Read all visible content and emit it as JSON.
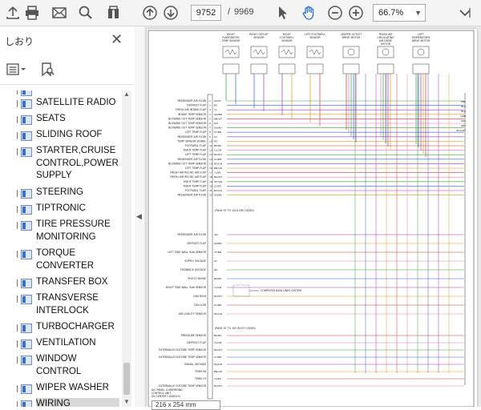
{
  "toolbar": {
    "icons": [
      "upload-icon",
      "print-icon",
      "email-icon",
      "search-icon",
      "bookmark-panel-icon",
      "prev-page-icon",
      "next-page-icon",
      "select-cursor-icon",
      "hand-tool-icon",
      "zoom-out-icon",
      "zoom-in-icon",
      "more-tools-icon"
    ],
    "page_current": "9752",
    "page_separator": "/",
    "page_total": "9969",
    "zoom": "66.7%"
  },
  "sidebar": {
    "title": "しおり",
    "items": [
      {
        "label": "SATELLITE RADIO"
      },
      {
        "label": "SEATS"
      },
      {
        "label": "SLIDING ROOF"
      },
      {
        "label": "STARTER,CRUISE CONTROL,POWER SUPPLY"
      },
      {
        "label": "STEERING"
      },
      {
        "label": "TIPTRONIC"
      },
      {
        "label": "TIRE PRESSURE MONITORING"
      },
      {
        "label": "TORQUE CONVERTER"
      },
      {
        "label": "TRANSFER BOX"
      },
      {
        "label": "TRANSVERSE INTERLOCK"
      },
      {
        "label": "TURBOCHARGER"
      },
      {
        "label": "VENTILATION"
      },
      {
        "label": "WINDOW CONTROL"
      },
      {
        "label": "WIPER WASHER"
      },
      {
        "label": "WIRING"
      }
    ]
  },
  "document": {
    "sensors": [
      "RIGHT EVAPORATOR TEMP SENSOR",
      "RIGHT OUTLET SENSOR",
      "RIGHT FOOTWELL SENSOR",
      "LEFT FOOTWELL SENSOR",
      "CENTER OUTLET DRIVE MOTOR",
      "FRESH AIR CIRCULATING AIR DRIVE MOTOR",
      "LEFT TEMPERATURE DRIVE MOTOR"
    ],
    "left_labels": [
      "PASSENGER AIR FLOW",
      "DEFROST FLAP",
      "FRESH AIR INTAKE FLAP",
      "INTAKE TEMP SENSOR",
      "BLOWING OUT TEMP SENSOR",
      "BLOWING OUT TEMP SENSOR",
      "BLOWING OUT TEMP SENSOR",
      "LEFT TEMP FLAP",
      "PASSENGER AIR FLOW",
      "TEMP SENSOR SIGNAL",
      "FOOTWELL FLAP",
      "RIGHT TEMP FLAP",
      "LEFT TEMP FLAP",
      "PASSENGER AIR FLOW",
      "BLOWING OUT TEMP SENSOR",
      "LEFT TEMP FLAP",
      "FRESH AIR RECIRC AIR FLAP",
      "FRESH AIR RECIRC AIR FLAP",
      "RIGHT TEMP FLAP",
      "RIGHT TEMP FLAP",
      "FOOTWELL FLAP",
      "PASSENGER AIR FLOW"
    ],
    "wire_colors": [
      "GN/YL",
      "BU",
      "YL",
      "GN/BN",
      "BN/WT",
      "GN",
      "GN/BU",
      "VT/BN",
      "GY",
      "RD",
      "BK/RD",
      "YL/GN",
      "BU/WT",
      "GY/BN",
      "RD/GN",
      "BN/GN",
      "YL/BK",
      "BU/WT",
      "WT/GN",
      "GY/RD",
      "BU/GN",
      "GN/BK"
    ],
    "right_labels": [
      "PNK",
      "BLU",
      "BLU",
      "GRN",
      "GRY",
      "GRY",
      "BLU/WT"
    ],
    "ref_top": "(PAGE 97 TO 1024 DM CODES)",
    "ref_mid": "(PAGE 97 TO 102 ROOT CODES)",
    "mid_labels": [
      "PASSENGER AIR FLOW",
      "DEFROST FLAP",
      "LEFT SIDE WALL SUN SENSOR",
      "SUPPLY VOLTAGE",
      "FEEDBACK VOLTAGE",
      "PHOTO DIODE",
      "RIGHT SIDE WALL SUN SENSOR",
      "CAN HIGH",
      "CAN LOW",
      "AIR QUALITY SENSOR"
    ],
    "computer_link": "COMPUTER DATA LINES SYSTEM",
    "lower_labels": [
      "PRESSURE SENSOR",
      "DEFROST FLAP",
      "EXTERNALLY OUTSIDE TEMP SENSOR",
      "EXTERNALLY OUTSIDE TEMP SENSOR",
      "SIGNAL GROUND",
      "TERM 58",
      "TERM 15",
      "EXTERNALLY OUTSIDE TEMP SENSOR"
    ],
    "footer": "A/C PANEL CLIMATRONIC CONTROL UNIT (IN CENTER CONSOLE)",
    "status": "216 x 254 mm"
  },
  "colors": {
    "wire_green": "#3a9a3a",
    "wire_blue": "#3a5cd4",
    "wire_purple": "#9a3ab0",
    "wire_orange": "#d89a28",
    "wire_red": "#c83a3a",
    "wire_pink": "#e07ab0",
    "toolbar_bg": "#f4f4f4"
  }
}
